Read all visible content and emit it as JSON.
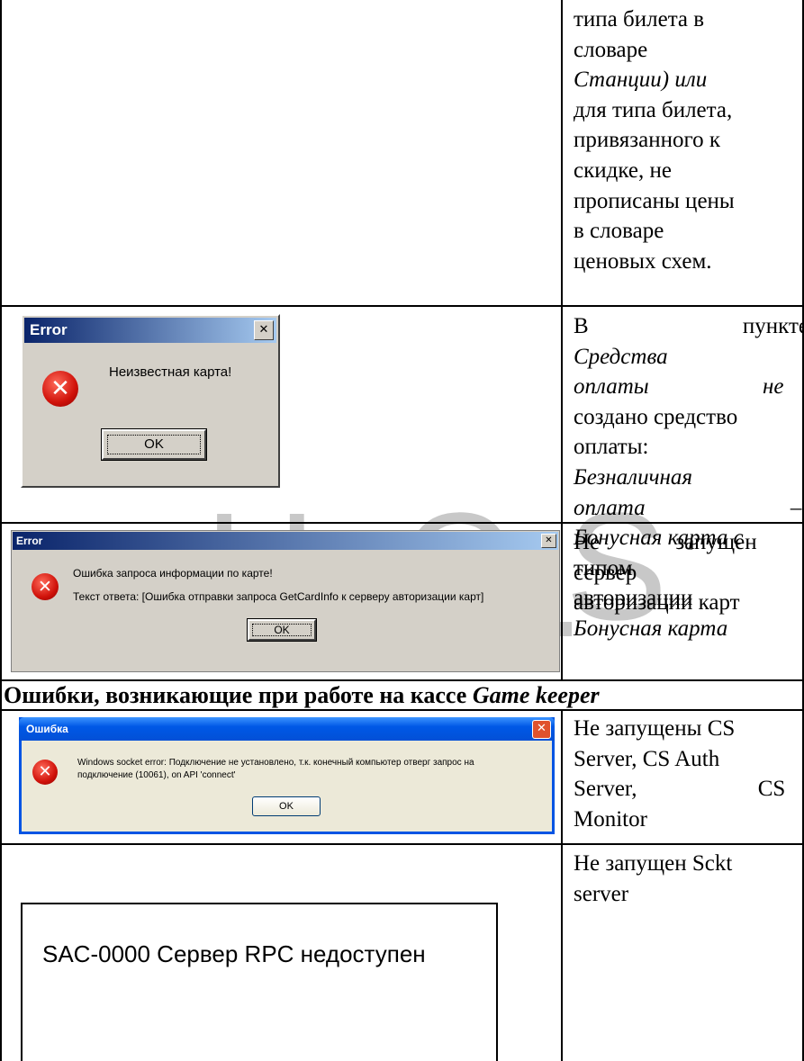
{
  "row1": {
    "lines": [
      "типа билета в",
      "словаре",
      "Станции) или",
      "для типа билета,",
      "привязанного к",
      "скидке, не",
      "прописаны цены",
      "в словаре",
      "ценовых схем."
    ]
  },
  "row2": {
    "dialog": {
      "title": "Error",
      "message": "Неизвестная карта!",
      "ok_label": "OK",
      "close_glyph": "✕",
      "icon": "error-icon"
    },
    "lines": [
      "В пункте",
      "Средства",
      "оплаты не",
      "создано средство",
      "оплаты:",
      "Безналичная",
      "оплата –",
      "Бонусная карта с",
      "типом",
      "авторизации",
      "Бонусная карта"
    ]
  },
  "row3": {
    "dialog": {
      "title": "Error",
      "message1": "Ошибка запроса информации по карте!",
      "message2": "Текст ответа: [Ошибка отправки запроса GetCardInfo к серверу авторизации карт]",
      "ok_label": "OK",
      "close_glyph": "✕"
    },
    "lines": [
      "Не запущен",
      "сервер",
      "авторизации карт"
    ]
  },
  "section_heading": {
    "prefix": "Ошибки, возникающие при работе на кассе ",
    "italic": "Game keeper"
  },
  "row4": {
    "dialog": {
      "title": "Ошибка",
      "message1": "Windows socket error: Подключение не установлено, т.к. конечный компьютер отверг запрос на",
      "message2": "подключение (10061), on API 'connect'",
      "ok_label": "OK",
      "close_glyph": "✕"
    },
    "lines": [
      "Не запущены CS",
      "Server, CS Auth",
      "Server, CS",
      "Monitor"
    ]
  },
  "row5": {
    "message": "SAC-0000 Сервер RPC недоступен",
    "lines": [
      "Не запущен Sckt",
      "server"
    ]
  },
  "watermark": [
    "U",
    "C",
    "S"
  ]
}
